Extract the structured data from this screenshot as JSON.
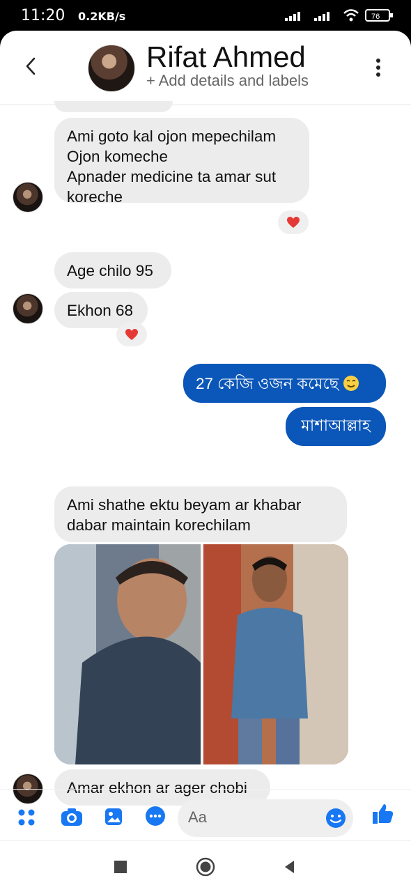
{
  "status": {
    "time": "11:20",
    "speed": "0.2KB/s",
    "battery": "76"
  },
  "header": {
    "name": "Rifat Ahmed",
    "subtitle": "+ Add details and labels"
  },
  "messages": {
    "m1": [
      "Ami goto kal ojon mepechilam",
      "Ojon komeche",
      "Apnader medicine ta amar sut",
      "koreche"
    ],
    "m2": "Age chilo 95",
    "m3": "Ekhon 68",
    "m4": "27 কেজি ওজন কমেছে",
    "m5": "মাশাআল্লাহ",
    "m6": [
      "Ami shathe ektu beyam ar khabar",
      "dabar maintain korechilam"
    ],
    "m7": "Amar ekhon ar ager chobi"
  },
  "composer": {
    "placeholder": "Aa"
  },
  "icons": {
    "back": "chevron-left-icon",
    "more": "more-vertical-icon",
    "apps": "apps-grid-icon",
    "camera": "camera-icon",
    "gallery": "image-gallery-icon",
    "messenger": "messenger-icon",
    "emoji": "emoji-icon",
    "like": "thumbs-up-icon"
  },
  "colors": {
    "accent": "#1877f2",
    "sent": "#0b56b9",
    "heart": "#e53935"
  }
}
